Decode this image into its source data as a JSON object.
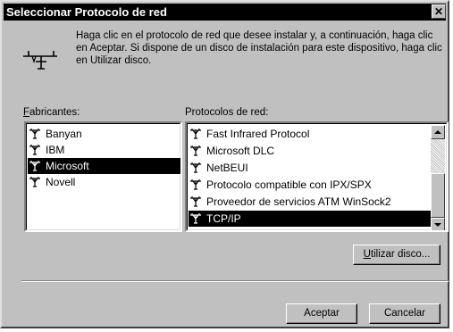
{
  "dialog": {
    "title": "Seleccionar Protocolo de red",
    "close_glyph": "✕",
    "intro": "Haga clic en el protocolo de red que desee instalar y, a continuación, haga clic en Aceptar. Si dispone de un disco de instalación para este dispositivo, haga clic en Utilizar disco."
  },
  "manufacturers": {
    "label_underlined": "F",
    "label_rest": "abricantes:",
    "items": [
      {
        "label": "Banyan",
        "selected": false
      },
      {
        "label": "IBM",
        "selected": false
      },
      {
        "label": "Microsoft",
        "selected": true
      },
      {
        "label": "Novell",
        "selected": false
      }
    ]
  },
  "protocols": {
    "label": "Protocolos de red:",
    "items": [
      {
        "label": "Fast Infrared Protocol",
        "selected": false
      },
      {
        "label": "Microsoft DLC",
        "selected": false
      },
      {
        "label": "NetBEUI",
        "selected": false
      },
      {
        "label": "Protocolo compatible con IPX/SPX",
        "selected": false
      },
      {
        "label": "Proveedor de servicios ATM WinSock2",
        "selected": false
      },
      {
        "label": "TCP/IP",
        "selected": true
      }
    ]
  },
  "buttons": {
    "have_disk_underlined": "U",
    "have_disk_rest": "tilizar disco...",
    "ok": "Aceptar",
    "cancel": "Cancelar"
  },
  "icons": {
    "network": "network-protocol-icon",
    "list_item": "network-protocol-icon",
    "scroll_up": "arrow-up-icon",
    "scroll_down": "arrow-down-icon"
  }
}
